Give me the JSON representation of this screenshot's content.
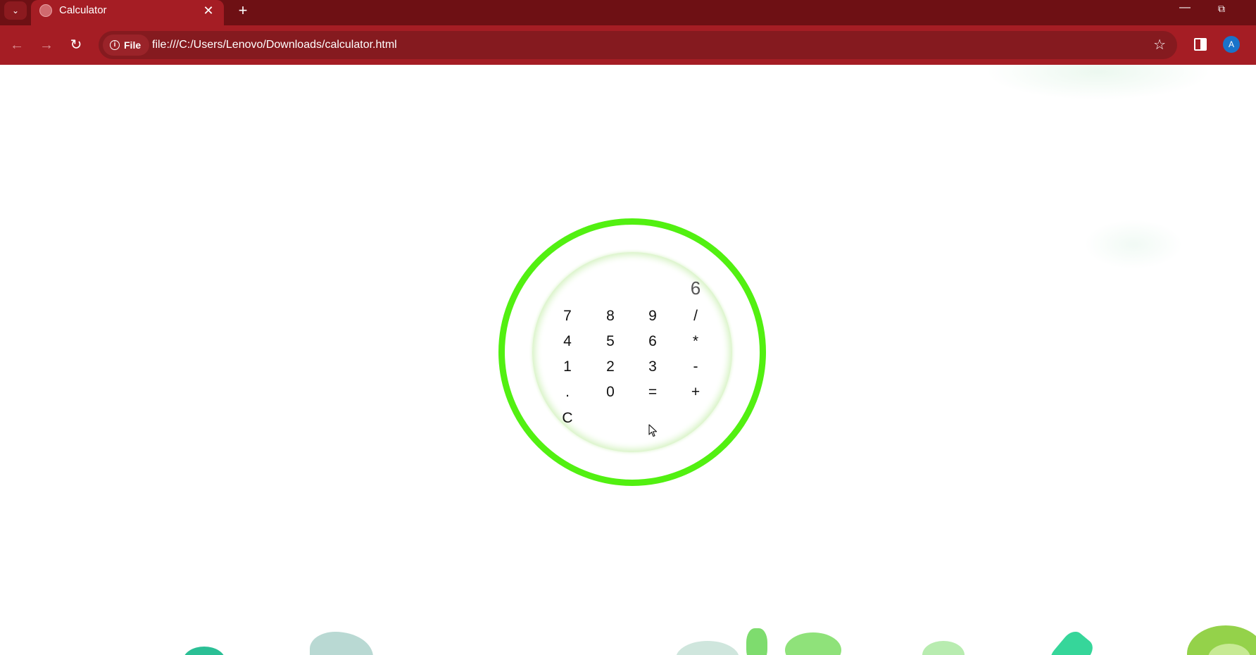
{
  "browser": {
    "tab_title": "Calculator",
    "tab_close": "✕",
    "new_tab": "+",
    "site_chip_label": "File",
    "url": "file:///C:/Users/Lenovo/Downloads/calculator.html",
    "avatar_letter": "A",
    "icons": {
      "tab_search": "chevron-down-icon",
      "back": "arrow-left-icon",
      "forward": "arrow-right-icon",
      "reload": "reload-icon",
      "info": "info-icon",
      "bookmark": "star-icon",
      "side_panel": "side-panel-icon",
      "minimize": "minimize-icon",
      "restore": "restore-icon"
    },
    "colors": {
      "tabstrip": "#6e1014",
      "toolbar": "#a51d24",
      "omnibox": "#851a1f"
    }
  },
  "calculator": {
    "display": "6",
    "ring_color": "#52f011",
    "keys": [
      [
        "7",
        "8",
        "9",
        "/"
      ],
      [
        "4",
        "5",
        "6",
        "*"
      ],
      [
        "1",
        "2",
        "3",
        "-"
      ],
      [
        ".",
        "0",
        "=",
        "+"
      ],
      [
        "C"
      ]
    ]
  }
}
